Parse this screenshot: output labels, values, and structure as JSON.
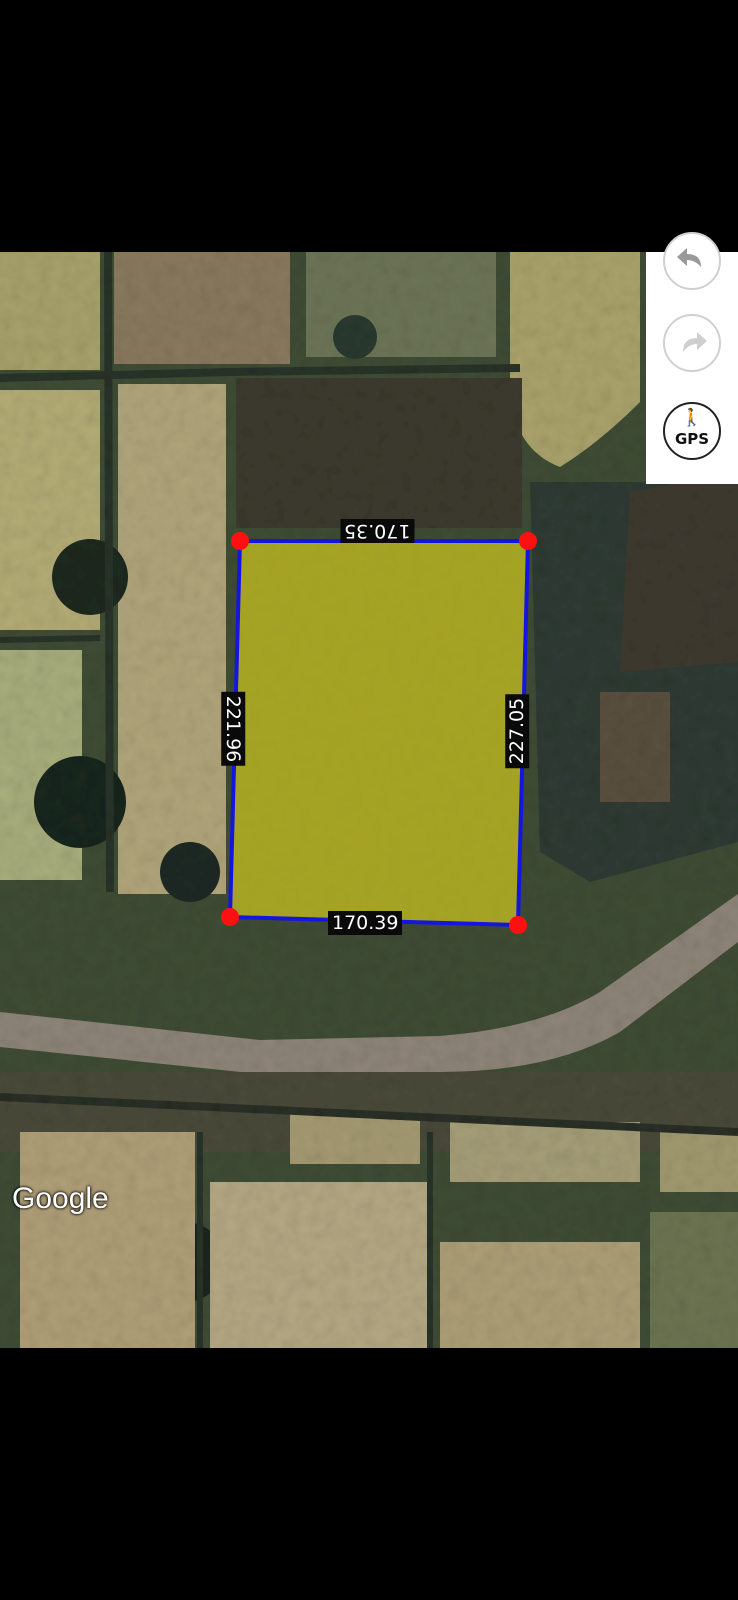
{
  "map": {
    "attribution": "Google",
    "polygon_fill_color": "#c8c020",
    "polygon_edge_color": "#1515e0",
    "vertex_color": "#ff1010",
    "measurements": {
      "top": "170.35",
      "left": "221.96",
      "right": "227.05",
      "bottom": "170.39"
    }
  },
  "toolbar": {
    "undo_icon": "undo-icon",
    "redo_icon": "redo-icon",
    "gps_label": "GPS",
    "gps_icon": "walking-person-icon"
  }
}
